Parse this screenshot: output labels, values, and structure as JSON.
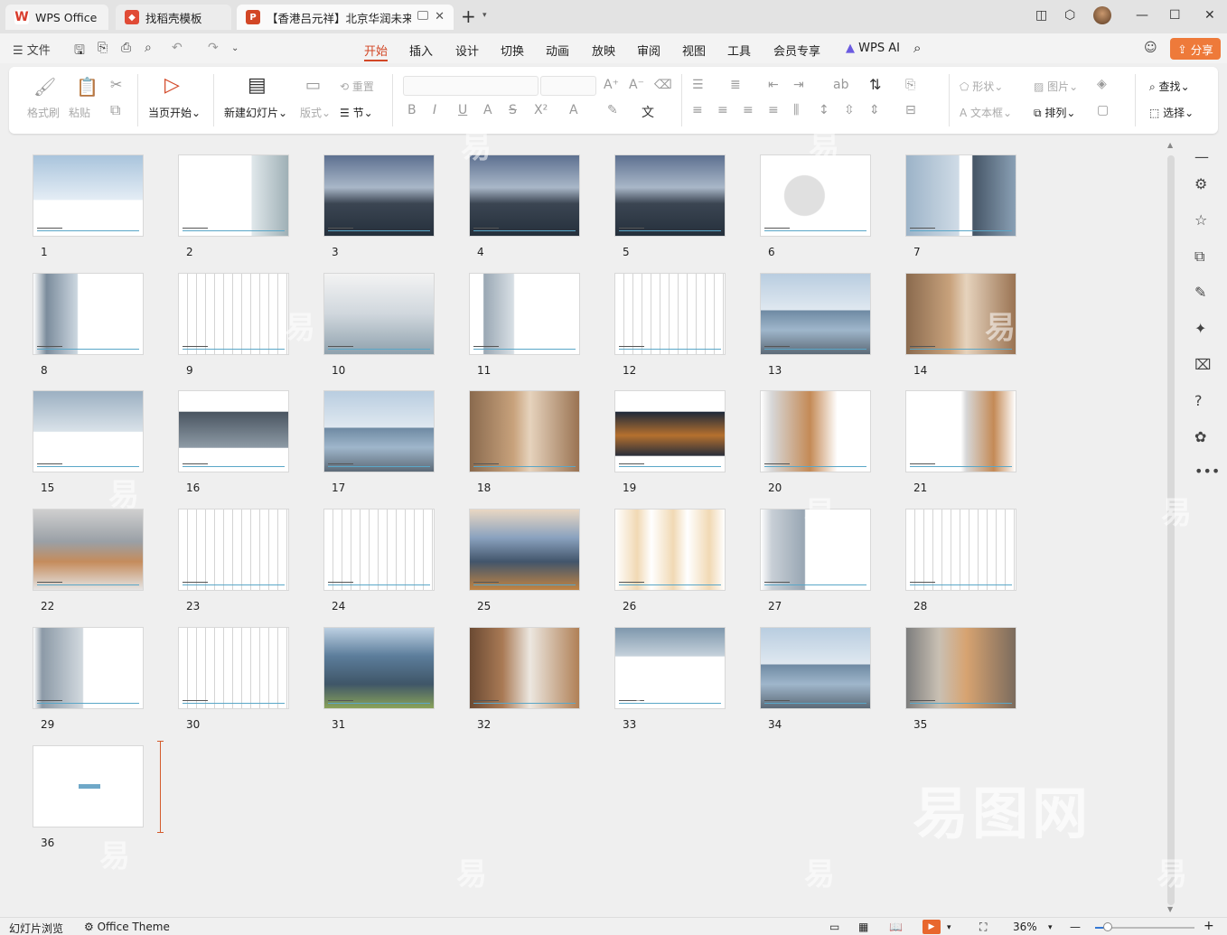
{
  "titlebar": {
    "tabs": [
      {
        "label": "WPS Office",
        "icon": "wps-logo-icon",
        "color": "#d93b2b"
      },
      {
        "label": "找稻壳模板",
        "icon": "docer-icon",
        "color": "#e04b36"
      },
      {
        "label": "【香港吕元祥】北京华润未来",
        "icon": "ppt-file-icon",
        "color": "#d24726"
      }
    ]
  },
  "menubar": {
    "file": "文件",
    "tabs": [
      "开始",
      "插入",
      "设计",
      "切换",
      "动画",
      "放映",
      "审阅",
      "视图",
      "工具",
      "会员专享"
    ],
    "active_tab": "开始",
    "wps_ai": "WPS AI",
    "share": "分享"
  },
  "ribbon": {
    "format_painter": "格式刷",
    "paste": "粘贴",
    "from_start": "当页开始",
    "new_slide": "新建幻灯片",
    "layout": "版式",
    "reset": "重置",
    "section": "节",
    "shape": "形状",
    "picture": "图片",
    "textbox": "文本框",
    "arrange": "排列",
    "find": "查找",
    "select": "选择"
  },
  "slides": [
    "1",
    "2",
    "3",
    "4",
    "5",
    "6",
    "7",
    "8",
    "9",
    "10",
    "11",
    "12",
    "13",
    "14",
    "15",
    "16",
    "17",
    "18",
    "19",
    "20",
    "21",
    "22",
    "23",
    "24",
    "25",
    "26",
    "27",
    "28",
    "29",
    "30",
    "31",
    "32",
    "33",
    "34",
    "35",
    "36"
  ],
  "statusbar": {
    "view_mode": "幻灯片浏览",
    "theme": "Office Theme",
    "zoom": "36%"
  },
  "colors": {
    "accent": "#d24726",
    "share": "#ee7a3a",
    "slide_rule": "#5aa7c8"
  }
}
